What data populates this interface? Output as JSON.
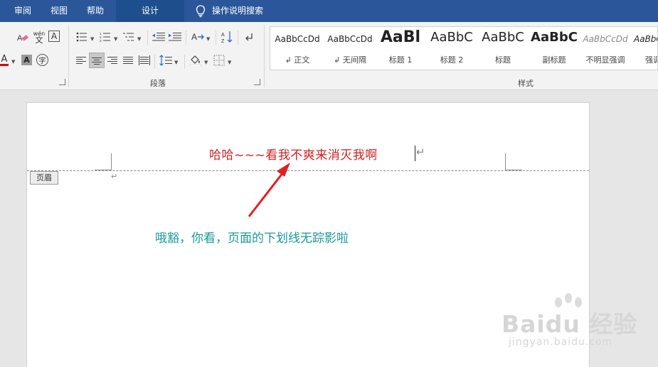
{
  "tabs": [
    {
      "label": "审阅"
    },
    {
      "label": "视图"
    },
    {
      "label": "帮助"
    },
    {
      "label": "设计"
    }
  ],
  "tell_me": {
    "label": "操作说明搜索"
  },
  "ribbon": {
    "font_glyphs": {
      "wen_top": "wén",
      "wen_bottom": "文",
      "char_border": "A",
      "font_color": "A",
      "char_shading": "A",
      "enclose": "字"
    },
    "groups": {
      "paragraph": "段落",
      "styles": "样式"
    }
  },
  "styles_gallery": [
    {
      "preview": "AaBbCcDd",
      "name": "↲ 正文"
    },
    {
      "preview": "AaBbCcDd",
      "name": "↲ 无间隔"
    },
    {
      "preview": "AaBl",
      "name": "标题 1"
    },
    {
      "preview": "AaBbC",
      "name": "标题 2"
    },
    {
      "preview": "AaBbC",
      "name": "标题"
    },
    {
      "preview": "AaBbC",
      "name": "副标题"
    },
    {
      "preview": "AaBbCcDd",
      "name": "不明显强调"
    },
    {
      "preview": "AaBbCcDd",
      "name": "强调"
    }
  ],
  "document": {
    "header_text": "哈哈~~~看我不爽来消灭我啊",
    "header_label": "页眉",
    "para_mark": "↵",
    "annotation": "哦豁，你看，页面的下划线无踪影啦"
  },
  "watermark": {
    "main": "Baidu 经验",
    "sub": "jingyan.baidu.com"
  },
  "colors": {
    "tab_bar": "#2b579a",
    "header_text": "#d21f1f",
    "annotation": "#1a9a96",
    "arrow": "#e02020"
  }
}
